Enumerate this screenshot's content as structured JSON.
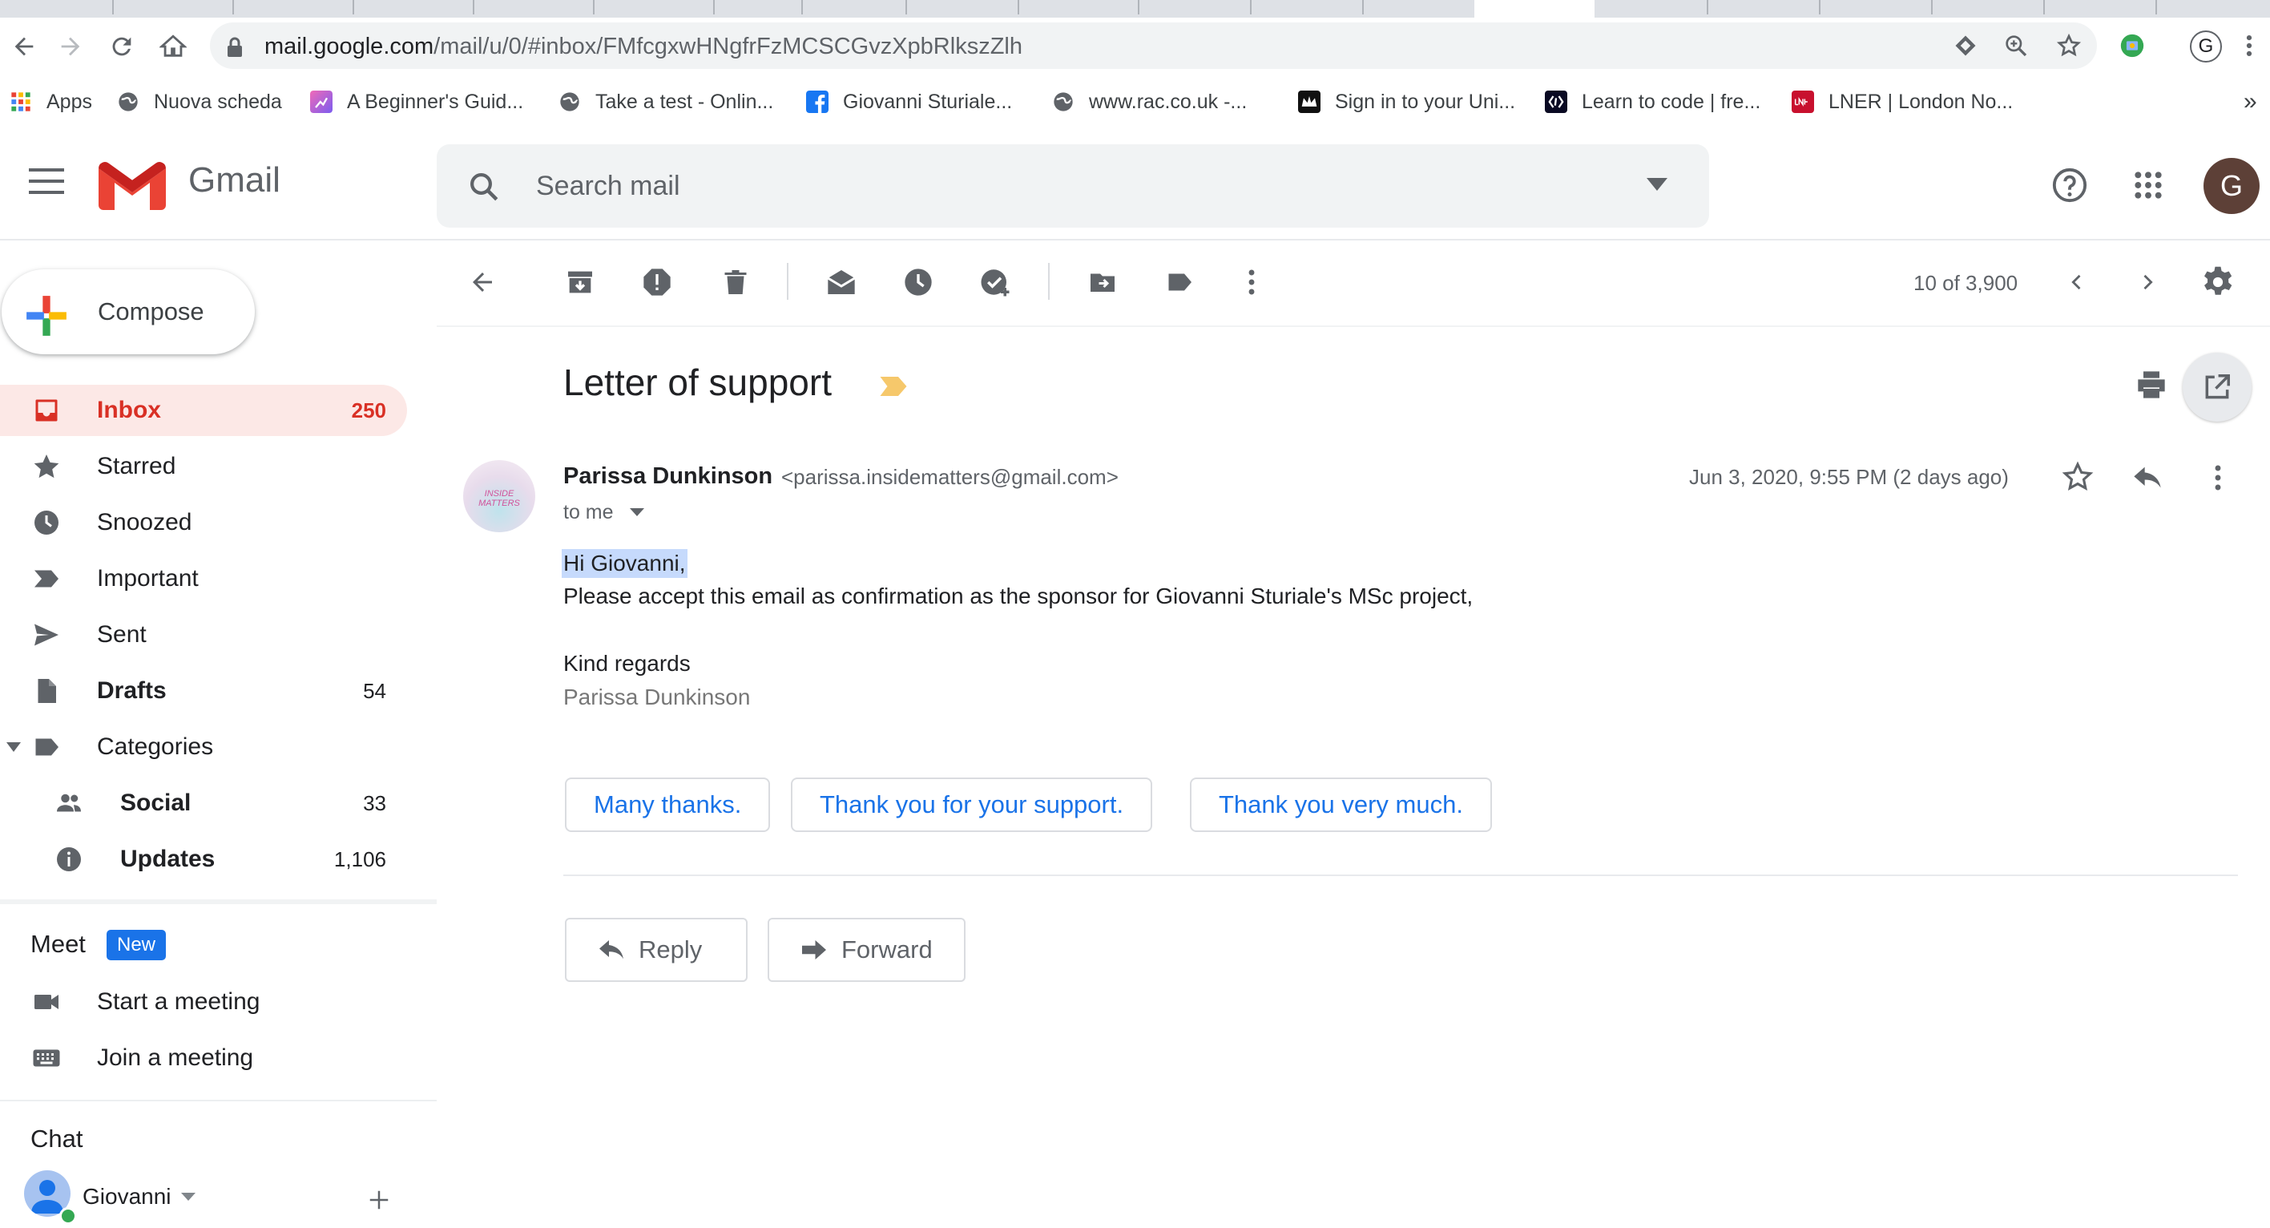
{
  "browser": {
    "url_host": "mail.google.com",
    "url_path": "/mail/u/0/#inbox/FMfcgxwHNgfrFzMCSCGvzXpbRlkszZlh",
    "profile_initial": "G",
    "bookmarks": [
      {
        "label": "Apps",
        "icon": "apps-grid-icon"
      },
      {
        "label": "Nuova scheda",
        "icon": "globe-icon"
      },
      {
        "label": "A Beginner's Guid...",
        "icon": "site-icon"
      },
      {
        "label": "Take a test - Onlin...",
        "icon": "globe-icon"
      },
      {
        "label": "Giovanni Sturiale...",
        "icon": "facebook-icon"
      },
      {
        "label": "www.rac.co.uk -...",
        "icon": "globe-icon"
      },
      {
        "label": "Sign in to your Uni...",
        "icon": "crown-icon"
      },
      {
        "label": "Learn to code | fre...",
        "icon": "code-icon"
      },
      {
        "label": "LNER | London No...",
        "icon": "lner-icon"
      }
    ],
    "bookmarks_overflow": "»"
  },
  "gmail": {
    "product_name": "Gmail",
    "search_placeholder": "Search mail",
    "account_initial": "G",
    "compose_label": "Compose",
    "nav": [
      {
        "label": "Inbox",
        "count": "250",
        "icon": "inbox-icon",
        "active": true
      },
      {
        "label": "Starred",
        "count": "",
        "icon": "star-icon"
      },
      {
        "label": "Snoozed",
        "count": "",
        "icon": "clock-icon"
      },
      {
        "label": "Important",
        "count": "",
        "icon": "important-icon"
      },
      {
        "label": "Sent",
        "count": "",
        "icon": "send-icon"
      },
      {
        "label": "Drafts",
        "count": "54",
        "icon": "draft-icon",
        "bold": true
      },
      {
        "label": "Categories",
        "count": "",
        "icon": "label-icon"
      },
      {
        "label": "Social",
        "count": "33",
        "icon": "people-icon",
        "bold": true
      },
      {
        "label": "Updates",
        "count": "1,106",
        "icon": "info-icon",
        "bold": true
      }
    ],
    "meet": {
      "title": "Meet",
      "badge": "New",
      "items": [
        {
          "label": "Start a meeting",
          "icon": "videocam-icon"
        },
        {
          "label": "Join a meeting",
          "icon": "keyboard-icon"
        }
      ]
    },
    "chat": {
      "title": "Chat",
      "user": "Giovanni"
    },
    "pager": "10 of 3,900",
    "message": {
      "subject": "Letter of support",
      "from_name": "Parissa Dunkinson",
      "from_email": "<parissa.insidematters@gmail.com>",
      "to": "to me",
      "date": "Jun 3, 2020, 9:55 PM (2 days ago)",
      "avatar_text": "INSIDE MATTERS",
      "body": [
        "Hi Giovanni,",
        "Please accept this email as confirmation as the sponsor for Giovanni Sturiale's MSc project,",
        "Kind regards",
        "Parissa Dunkinson"
      ],
      "smart_replies": [
        "Many thanks.",
        "Thank you for your support.",
        "Thank you very much."
      ],
      "reply_label": "Reply",
      "forward_label": "Forward"
    }
  },
  "colors": {
    "accent_red": "#d93025",
    "inbox_active_bg": "#fce8e6",
    "link_blue": "#1a73e8",
    "selection": "#c6dafc",
    "label_yellow": "#f6c86b"
  }
}
